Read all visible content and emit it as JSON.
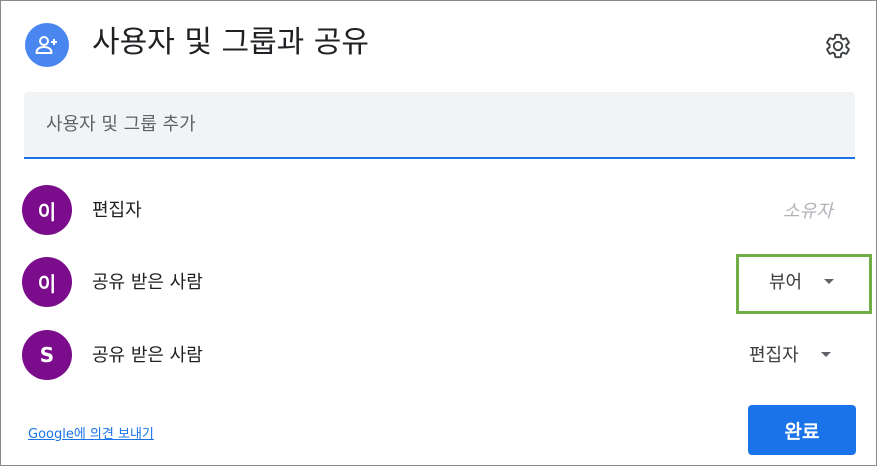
{
  "dialog": {
    "title": "사용자 및 그룹과 공유",
    "add_people_placeholder": "사용자 및 그룹 추가"
  },
  "people": [
    {
      "avatar_letter": "이",
      "name": "편집자",
      "role": "소유자",
      "is_owner": true
    },
    {
      "avatar_letter": "이",
      "name": "공유 받은 사람",
      "role": "뷰어",
      "is_owner": false
    },
    {
      "avatar_letter": "S",
      "name": "공유 받은 사람",
      "role": "편집자",
      "is_owner": false
    }
  ],
  "footer": {
    "feedback_link": "Google에 의견 보내기",
    "done_button": "완료"
  },
  "colors": {
    "accent": "#1a73e8",
    "avatar": "#7b0d8c",
    "highlight": "#70ad47"
  },
  "icons": {
    "header": "add-person-icon",
    "settings": "gear-icon",
    "dropdown": "caret-down-icon"
  }
}
